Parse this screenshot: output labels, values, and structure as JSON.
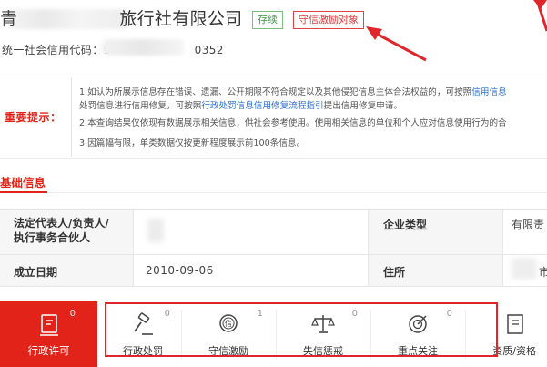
{
  "header": {
    "company_name": "青          旅行社有限公司",
    "badges": [
      "存续",
      "守信激励对象"
    ],
    "credit_code_label": "统一社会信用代码：",
    "credit_code_value": "9              0352"
  },
  "notice": {
    "label": "重要提示：",
    "line1a": "1.如认为所展示信息存在错误、遗漏、公开期限不符合规定以及其他侵犯信息主体合法权益的，可按照",
    "line1a_link": "信用信息",
    "line1b_pre": "处罚信息进行信用修复，可按照",
    "line1b_link": "行政处罚信息信用修复流程指引",
    "line1b_post": "提出信用修复申请。",
    "line2": "2.本查询结果仅依现有数据展示相关信息，供社会参考使用。使用相关信息的单位和个人应对信息使用行为的合",
    "line3": "3.因篇幅有限，单类数据仅按更新程度展示前100条信息。"
  },
  "section": {
    "tab": "基础信息"
  },
  "table": {
    "rep_label": "法定代表人/负责人/执行事务合伙人",
    "rep_label_line1": "法定代表人/负责人/",
    "rep_label_line2": "执行事务合伙人",
    "type_label": "企业类型",
    "type_value": "有限责",
    "date_label": "成立日期",
    "date_value": "2010-09-06",
    "addr_label": "住所",
    "addr_value": "市"
  },
  "nav": {
    "items": [
      {
        "label": "行政许可",
        "count": "0",
        "icon": "license-icon"
      },
      {
        "label": "行政处罚",
        "count": "0",
        "icon": "gavel-icon"
      },
      {
        "label": "守信激励",
        "count": "1",
        "icon": "trust-medal-icon"
      },
      {
        "label": "失信惩戒",
        "count": "0",
        "icon": "scales-icon"
      },
      {
        "label": "重点关注",
        "count": "0",
        "icon": "target-icon"
      },
      {
        "label": "资质/资格",
        "count": "",
        "icon": "certificate-icon"
      }
    ]
  },
  "colors": {
    "accent": "#e2231a",
    "green": "#3b9a43",
    "link": "#2c6fd1"
  }
}
